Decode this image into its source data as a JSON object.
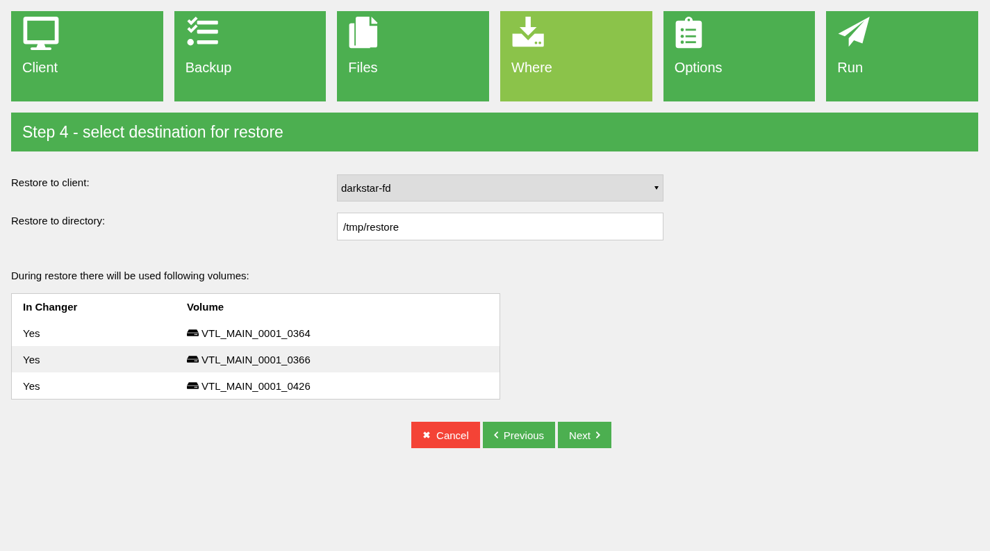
{
  "steps": [
    {
      "label": "Client",
      "selected": false
    },
    {
      "label": "Backup",
      "selected": false
    },
    {
      "label": "Files",
      "selected": false
    },
    {
      "label": "Where",
      "selected": true
    },
    {
      "label": "Options",
      "selected": false
    },
    {
      "label": "Run",
      "selected": false
    }
  ],
  "step_title": "Step 4 - select destination for restore",
  "form": [
    {
      "kind": "select",
      "label": "Restore to client:",
      "value": "darkstar-fd"
    },
    {
      "kind": "text",
      "label": "Restore to directory:",
      "value": "/tmp/restore"
    }
  ],
  "volumes_note": "During restore there will be used following volumes:",
  "table": {
    "columns": [
      "In Changer",
      "Volume"
    ],
    "rows": [
      {
        "in_changer": "Yes",
        "volume": "VTL_MAIN_0001_0364"
      },
      {
        "in_changer": "Yes",
        "volume": "VTL_MAIN_0001_0366"
      },
      {
        "in_changer": "Yes",
        "volume": "VTL_MAIN_0001_0426"
      }
    ]
  },
  "buttons": [
    {
      "kind": "cancel",
      "label": "Cancel"
    },
    {
      "kind": "previous",
      "label": "Previous"
    },
    {
      "kind": "next",
      "label": "Next"
    }
  ]
}
